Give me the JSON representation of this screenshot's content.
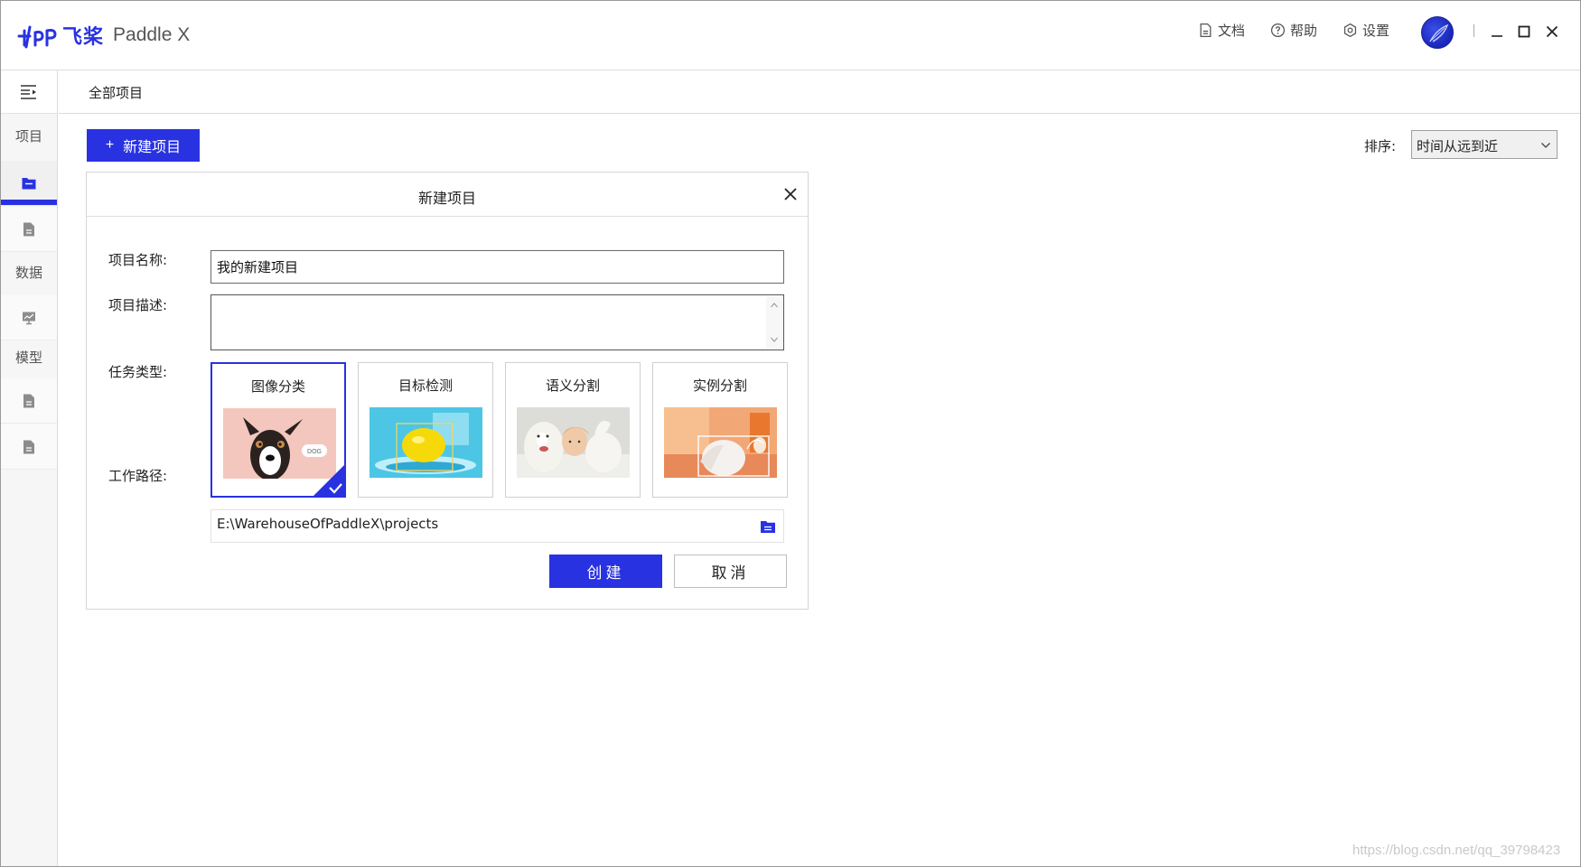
{
  "app": {
    "logo_cn": "飞桨",
    "logo_en": "Paddle X",
    "accent_color": "#2932e1"
  },
  "topbar": {
    "docs_label": "文档",
    "help_label": "帮助",
    "settings_label": "设置",
    "docs_icon": "document-icon",
    "help_icon": "question-circle-icon",
    "settings_icon": "gear-icon"
  },
  "sidebar": {
    "sections": [
      {
        "label": "项目"
      },
      {
        "label": "数据"
      },
      {
        "label": "模型"
      }
    ],
    "items": [
      {
        "icon": "folder-icon",
        "active": true
      },
      {
        "icon": "file-icon",
        "active": false
      },
      {
        "icon": "monitor-chart-icon",
        "active": false
      },
      {
        "icon": "file-icon",
        "active": false
      },
      {
        "icon": "file-icon",
        "active": false
      }
    ]
  },
  "breadcrumb": "全部项目",
  "toolbar": {
    "new_project_label": "新建项目",
    "sort_label": "排序:",
    "sort_value": "时间从远到近"
  },
  "dialog": {
    "title": "新建项目",
    "name_label": "项目名称:",
    "name_value": "我的新建项目",
    "desc_label": "项目描述:",
    "desc_value": "",
    "task_label": "任务类型:",
    "tasks": [
      {
        "label": "图像分类",
        "selected": true
      },
      {
        "label": "目标检测",
        "selected": false
      },
      {
        "label": "语义分割",
        "selected": false
      },
      {
        "label": "实例分割",
        "selected": false
      }
    ],
    "path_label": "工作路径:",
    "path_value": "E:\\WarehouseOfPaddleX\\projects",
    "create_label": "创建",
    "cancel_label": "取消"
  },
  "watermark": "https://blog.csdn.net/qq_39798423"
}
